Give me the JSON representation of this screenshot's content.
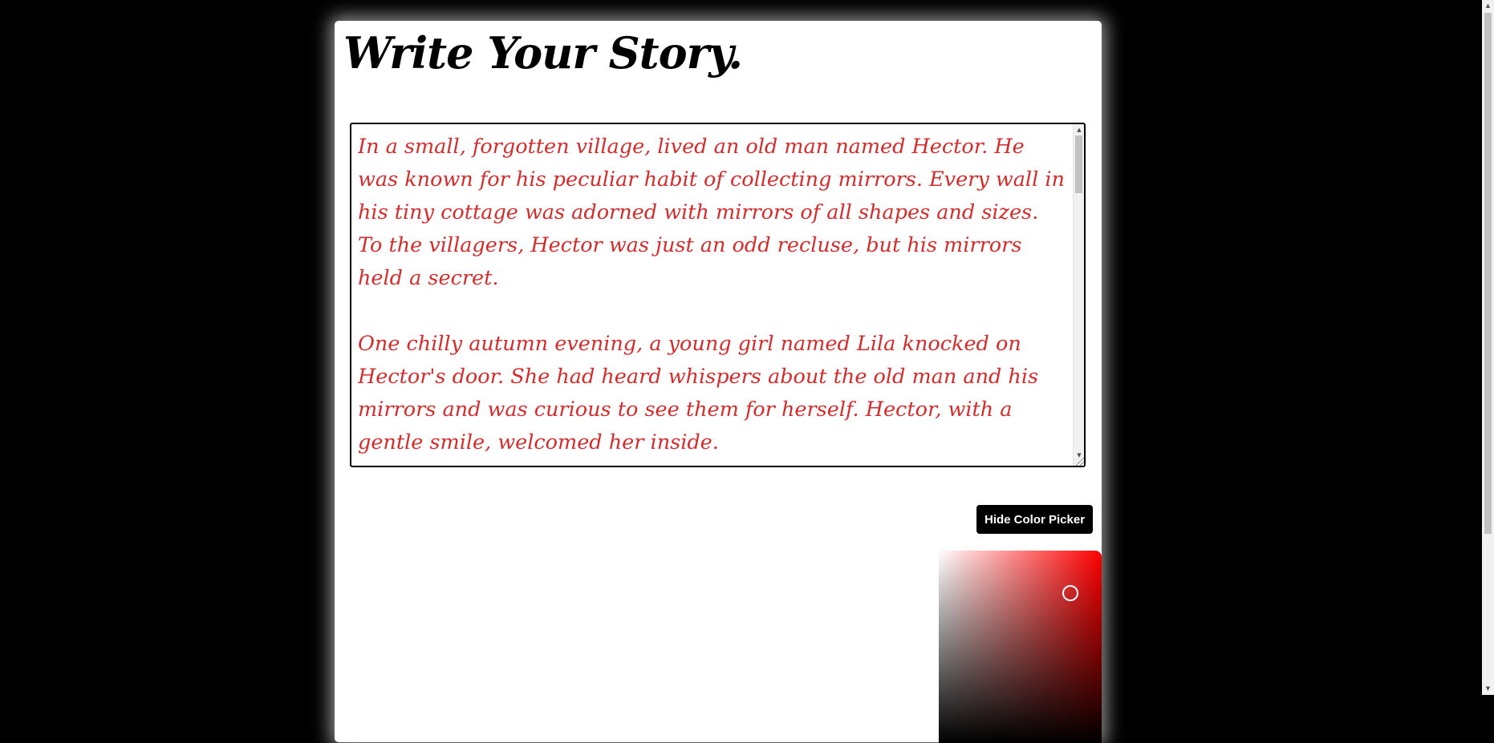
{
  "page": {
    "title": "Write Your Story."
  },
  "editor": {
    "text": "In a small, forgotten village, lived an old man named Hector. He was known for his peculiar habit of collecting mirrors. Every wall in his tiny cottage was adorned with mirrors of all shapes and sizes. To the villagers, Hector was just an odd recluse, but his mirrors held a secret.\n\nOne chilly autumn evening, a young girl named Lila knocked on Hector's door. She had heard whispers about the old man and his mirrors and was curious to see them for herself. Hector, with a gentle smile, welcomed her inside.\n\nAs Lila stepped into the cottage, she was overwhelmed by her own reflections",
    "text_color": "#d62b2b"
  },
  "color_picker": {
    "toggle_label": "Hide Color Picker",
    "hue_color": "#ff0000",
    "selected_color": "#d62b2b"
  },
  "icons": {
    "scroll_up": "▲",
    "scroll_down": "▼"
  }
}
